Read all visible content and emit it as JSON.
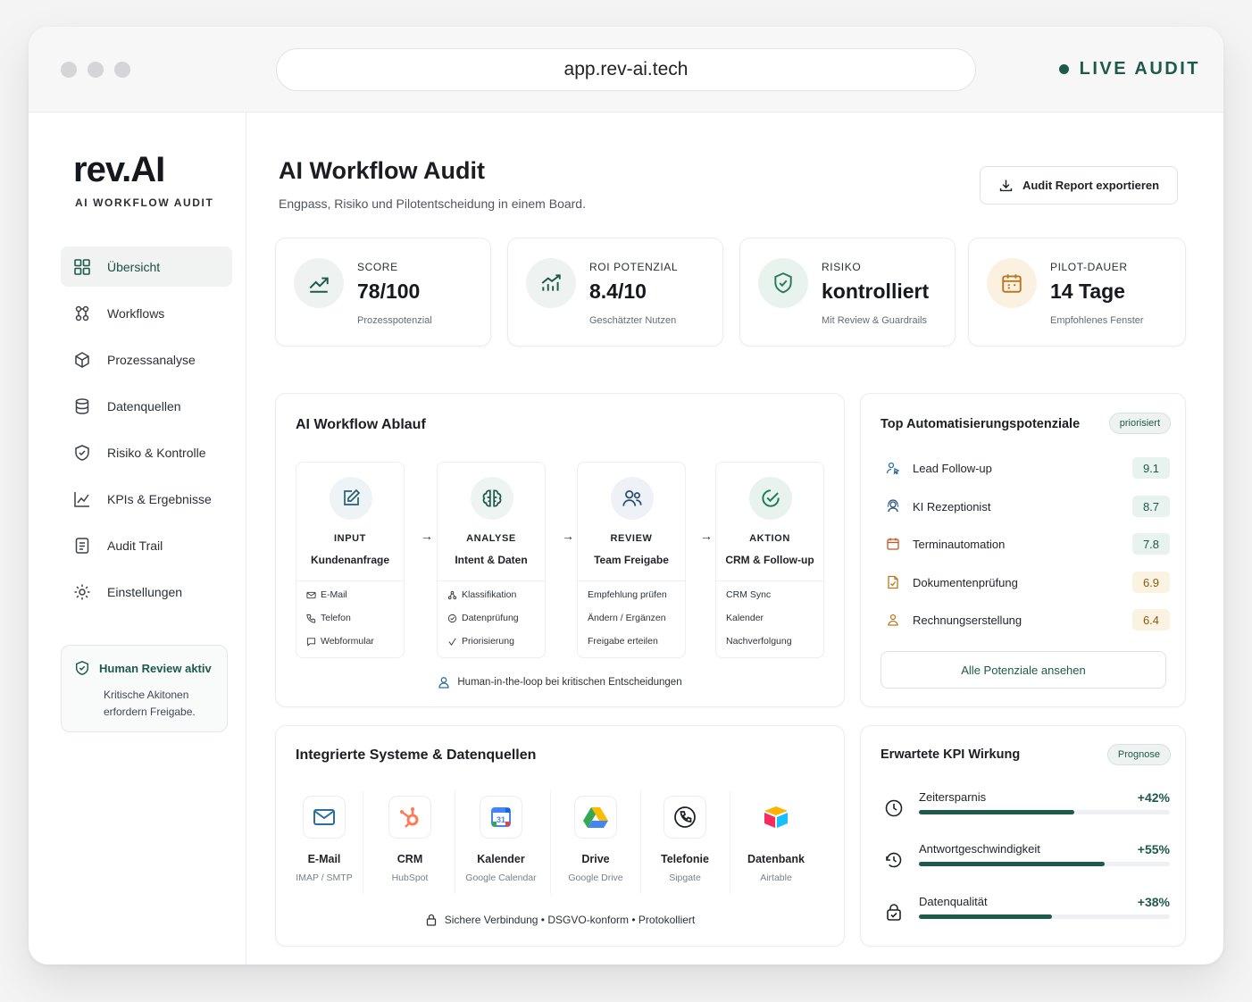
{
  "window": {
    "url": "app.rev-ai.tech",
    "live_label": "LIVE AUDIT"
  },
  "sidebar": {
    "logo": "rev.AI",
    "logo_sub": "AI WORKFLOW AUDIT",
    "items": [
      {
        "label": "Übersicht",
        "icon": "grid-icon",
        "active": true
      },
      {
        "label": "Workflows",
        "icon": "workflow-icon"
      },
      {
        "label": "Prozessanalyse",
        "icon": "cube-icon"
      },
      {
        "label": "Datenquellen",
        "icon": "database-icon"
      },
      {
        "label": "Risiko & Kontrolle",
        "icon": "shield-icon"
      },
      {
        "label": "KPIs & Ergebnisse",
        "icon": "chart-line-icon"
      },
      {
        "label": "Audit Trail",
        "icon": "document-icon"
      },
      {
        "label": "Einstellungen",
        "icon": "gear-icon"
      }
    ],
    "review": {
      "title": "Human Review aktiv",
      "text": "Kritische Akitonen erfordern Freigabe."
    }
  },
  "header": {
    "title": "AI Workflow Audit",
    "subtitle": "Engpass, Risiko und Pilotentscheidung in einem Board.",
    "export_label": "Audit Report exportieren"
  },
  "stats": [
    {
      "label": "SCORE",
      "value": "78/100",
      "sub": "Prozesspotenzial",
      "icon": "trend-up-icon"
    },
    {
      "label": "ROI POTENZIAL",
      "value": "8.4/10",
      "sub": "Geschätzter Nutzen",
      "icon": "chart-growth-icon"
    },
    {
      "label": "RISIKO",
      "value": "kontrolliert",
      "sub": "Mit Review & Guardrails",
      "icon": "shield-check-icon"
    },
    {
      "label": "PILOT-DAUER",
      "value": "14 Tage",
      "sub": "Empfohlenes Fenster",
      "icon": "calendar-icon"
    }
  ],
  "flow": {
    "title": "AI Workflow Ablauf",
    "steps": [
      {
        "stage": "INPUT",
        "name": "Kundenanfrage",
        "items": [
          "E-Mail",
          "Telefon",
          "Webformular"
        ]
      },
      {
        "stage": "ANALYSE",
        "name": "Intent & Daten",
        "items": [
          "Klassifikation",
          "Datenprüfung",
          "Priorisierung"
        ]
      },
      {
        "stage": "REVIEW",
        "name": "Team Freigabe",
        "items": [
          "Empfehlung prüfen",
          "Ändern / Ergänzen",
          "Freigabe erteilen"
        ]
      },
      {
        "stage": "AKTION",
        "name": "CRM & Follow-up",
        "items": [
          "CRM Sync",
          "Kalender",
          "Nachverfolgung"
        ]
      }
    ],
    "arrow": "→",
    "footer": "Human-in-the-loop bei kritischen Entscheidungen"
  },
  "potentials": {
    "title": "Top Automatisierungspotenziale",
    "badge": "priorisiert",
    "items": [
      {
        "name": "Lead Follow-up",
        "score": "9.1"
      },
      {
        "name": "KI Rezeptionist",
        "score": "8.7"
      },
      {
        "name": "Terminautomation",
        "score": "7.8"
      },
      {
        "name": "Dokumentenprüfung",
        "score": "6.9"
      },
      {
        "name": "Rechnungserstellung",
        "score": "6.4"
      }
    ],
    "button": "Alle Potenziale ansehen"
  },
  "systems": {
    "title": "Integrierte Systeme & Datenquellen",
    "items": [
      {
        "name": "E-Mail",
        "sub": "IMAP / SMTP",
        "icon": "mail-icon"
      },
      {
        "name": "CRM",
        "sub": "HubSpot",
        "icon": "hubspot-icon"
      },
      {
        "name": "Kalender",
        "sub": "Google Calendar",
        "icon": "google-calendar-icon"
      },
      {
        "name": "Drive",
        "sub": "Google Drive",
        "icon": "google-drive-icon"
      },
      {
        "name": "Telefonie",
        "sub": "Sipgate",
        "icon": "phone-icon"
      },
      {
        "name": "Datenbank",
        "sub": "Airtable",
        "icon": "airtable-icon"
      }
    ],
    "footer": "Sichere Verbindung  •  DSGVO-konform  •  Protokolliert"
  },
  "kpi": {
    "title": "Erwartete KPI Wirkung",
    "badge": "Prognose",
    "items": [
      {
        "name": "Zeitersparnis",
        "value": "+42%",
        "progress": 0.62
      },
      {
        "name": "Antwortgeschwindigkeit",
        "value": "+55%",
        "progress": 0.74
      },
      {
        "name": "Datenqualität",
        "value": "+38%",
        "progress": 0.53
      }
    ]
  },
  "colors": {
    "accent": "#1d5a4a",
    "score_green_bg": "#e8f2ee",
    "score_amber_bg": "#fbf3e2"
  }
}
